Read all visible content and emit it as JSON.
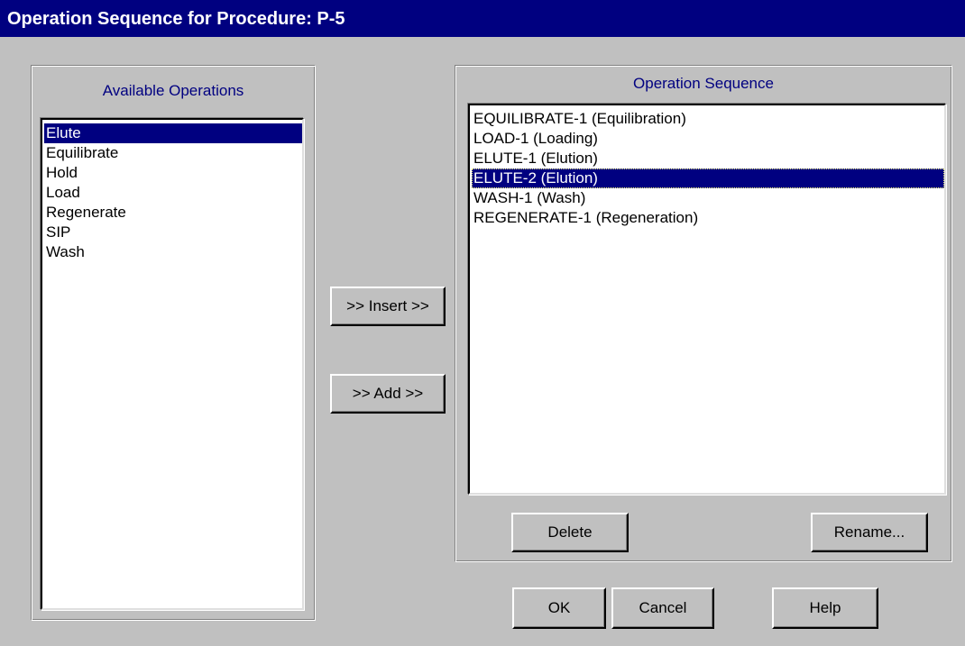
{
  "window": {
    "title": "Operation Sequence for Procedure: P-5"
  },
  "available": {
    "title": "Available Operations",
    "items": [
      "Elute",
      "Equilibrate",
      "Hold",
      "Load",
      "Regenerate",
      "SIP",
      "Wash"
    ],
    "selected_index": 0
  },
  "actions": {
    "insert_label": ">> Insert >>",
    "add_label": ">> Add >>"
  },
  "sequence": {
    "title": "Operation Sequence",
    "items": [
      "EQUILIBRATE-1 (Equilibration)",
      "LOAD-1 (Loading)",
      "ELUTE-1 (Elution)",
      "ELUTE-2 (Elution)",
      "WASH-1 (Wash)",
      "REGENERATE-1 (Regeneration)"
    ],
    "selected_index": 3,
    "delete_label": "Delete",
    "rename_label": "Rename..."
  },
  "footer": {
    "ok_label": "OK",
    "cancel_label": "Cancel",
    "help_label": "Help"
  },
  "colors": {
    "titlebar": "#000080",
    "selection": "#000080",
    "group_title": "#000080",
    "face": "#c0c0c0"
  }
}
